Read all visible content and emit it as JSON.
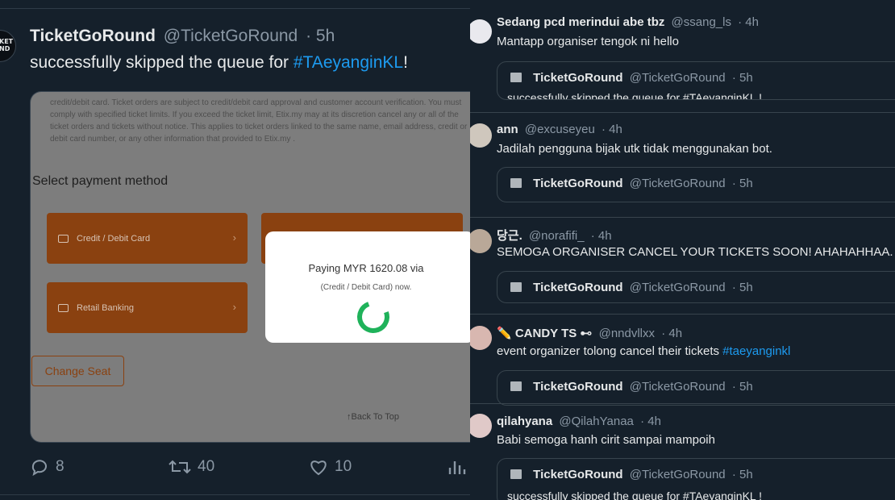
{
  "main_tweet": {
    "name": "TicketGoRound",
    "handle": "@TicketGoRound",
    "time": "· 5h",
    "text": "successfully skipped the queue for ",
    "hashtag": "#TAeyanginKL",
    "text_end": "!",
    "avatar_text": "KET\nND",
    "media": {
      "terms_text": "credit/debit card. Ticket orders are subject to credit/debit card approval and customer account verification. You must comply with specified ticket limits. If you exceed the ticket limit, Etix.my may at its discretion cancel any or all of the ticket orders and tickets without notice. This applies to ticket orders linked to the same name, email address, credit or debit card number, or any other information that provided to Etix.my .",
      "section_title": "Select payment method",
      "option_credit": "Credit / Debit Card",
      "option_retail": "Retail Banking",
      "change_seat": "Change Seat",
      "back_to_top": "↑Back To Top",
      "modal_line1": "Paying MYR 1620.08 via",
      "modal_line2": "(Credit / Debit Card) now."
    },
    "actions": {
      "replies": "8",
      "retweets": "40",
      "likes": "10"
    }
  },
  "replies": [
    {
      "name": "Sedang pcd merindui abe tbz",
      "handle": "@ssang_ls",
      "time": "· 4h",
      "text": "Mantapp organiser tengok ni hello",
      "quote": {
        "name": "TicketGoRound",
        "handle": "@TicketGoRound",
        "time": "· 5h",
        "text": "successfully skipped the queue for #TAeyanginKL !"
      }
    },
    {
      "name": "ann",
      "handle": "@excuseyeu",
      "time": "· 4h",
      "text": "Jadilah pengguna bijak utk tidak menggunakan bot.",
      "quote": {
        "name": "TicketGoRound",
        "handle": "@TicketGoRound",
        "time": "· 5h",
        "text": ""
      }
    },
    {
      "name": "당근.",
      "handle": "@norafifi_",
      "time": "· 4h",
      "text": "SEMOGA ORGANISER CANCEL YOUR TICKETS SOON! AHAHAHHAA.",
      "quote": {
        "name": "TicketGoRound",
        "handle": "@TicketGoRound",
        "time": "· 5h",
        "text": ""
      }
    },
    {
      "name": "✏️ CANDY TS ⊷",
      "handle": "@nndvllxx",
      "time": "· 4h",
      "text": "event organizer tolong cancel their tickets ",
      "hashtag": "#taeyanginkl",
      "quote": {
        "name": "TicketGoRound",
        "handle": "@TicketGoRound",
        "time": "· 5h",
        "text": ""
      }
    },
    {
      "name": "qilahyana",
      "handle": "@QilahYanaa",
      "time": "· 4h",
      "text": "Babi semoga hanh cirit sampai mampoih",
      "quote": {
        "name": "TicketGoRound",
        "handle": "@TicketGoRound",
        "time": "· 5h",
        "text": "successfully skipped the queue for #TAeyanginKL !"
      }
    }
  ],
  "colors": {
    "background": "#15202b",
    "hashtag": "#1d9bf0",
    "secondary_text": "#8b98a5",
    "orange": "#8a4110",
    "spinner": "#1fb25a"
  }
}
